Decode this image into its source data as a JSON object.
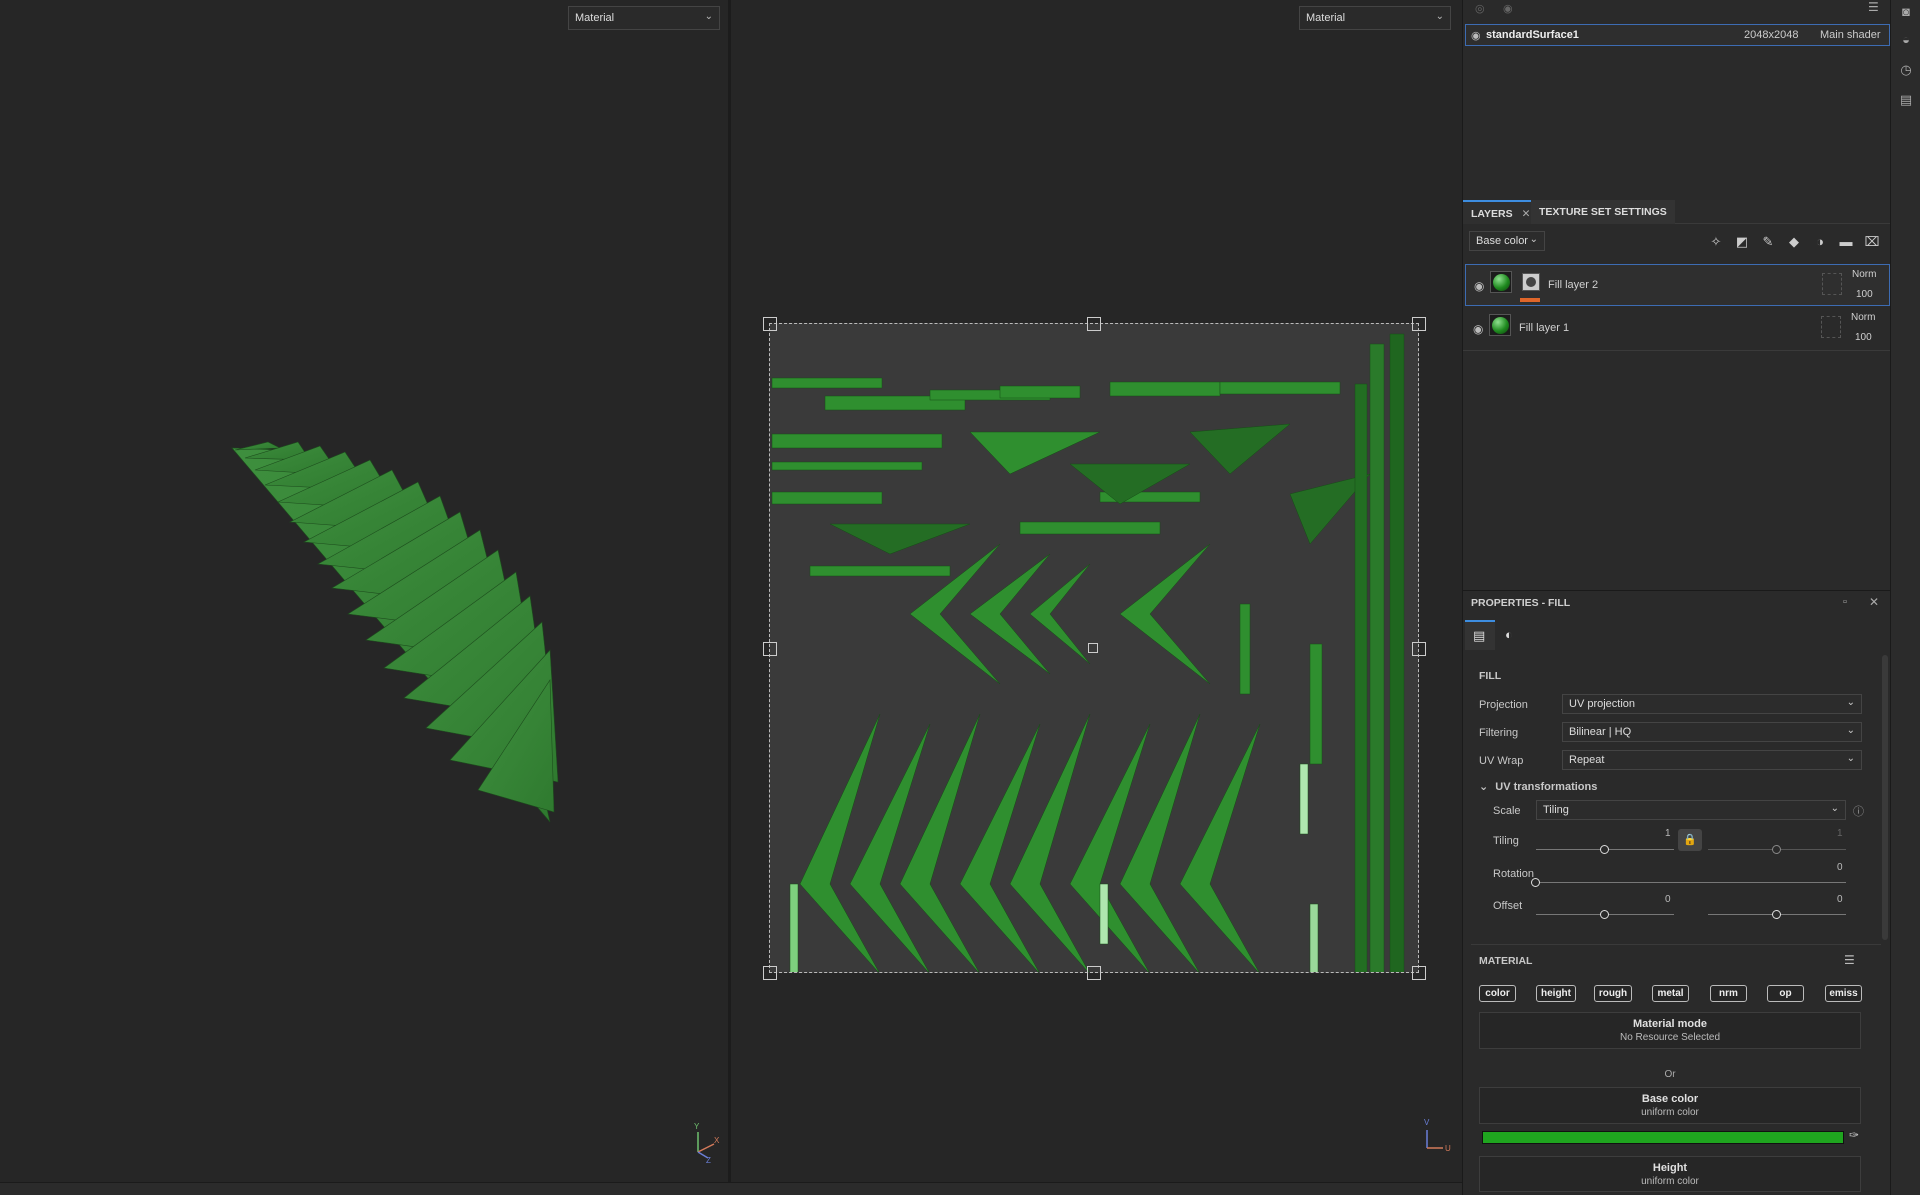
{
  "viewport3d": {
    "material_select": "Material",
    "axis_y": "Y",
    "axis_x": "X",
    "axis_z": "Z"
  },
  "viewport2d": {
    "material_select": "Material",
    "axis_v": "V",
    "axis_u": "U"
  },
  "texture_set": {
    "name": "standardSurface1",
    "resolution": "2048x2048",
    "shader": "Main shader"
  },
  "tabs": {
    "layers": "LAYERS",
    "texture_set_settings": "TEXTURE SET SETTINGS"
  },
  "channel_select": "Base color",
  "layers": [
    {
      "name": "Fill layer 2",
      "blend": "Norm",
      "opacity": "100"
    },
    {
      "name": "Fill layer 1",
      "blend": "Norm",
      "opacity": "100"
    }
  ],
  "properties": {
    "title": "PROPERTIES - FILL",
    "fill_section": "FILL",
    "projection_label": "Projection",
    "projection_value": "UV projection",
    "filtering_label": "Filtering",
    "filtering_value": "Bilinear | HQ",
    "uvwrap_label": "UV Wrap",
    "uvwrap_value": "Repeat",
    "uv_section": "UV transformations",
    "scale_label": "Scale",
    "scale_value": "Tiling",
    "tiling_label": "Tiling",
    "tiling_value_1": "1",
    "tiling_value_2": "1",
    "rotation_label": "Rotation",
    "rotation_value": "0",
    "offset_label": "Offset",
    "offset_value_1": "0",
    "offset_value_2": "0",
    "material_section": "MATERIAL",
    "channels": [
      "color",
      "height",
      "rough",
      "metal",
      "nrm",
      "op",
      "emiss"
    ],
    "material_mode_title": "Material mode",
    "material_mode_sub": "No Resource Selected",
    "or_text": "Or",
    "base_color_title": "Base color",
    "base_color_sub": "uniform color",
    "base_color_hex": "#1fa51f",
    "height_title": "Height",
    "height_sub": "uniform color"
  },
  "controls": {
    "tiling_pos": 0.5,
    "tiling2_pos": 0.5,
    "rotation_pos": 0.0,
    "offset_pos": 0.5,
    "offset2_pos": 0.5
  }
}
